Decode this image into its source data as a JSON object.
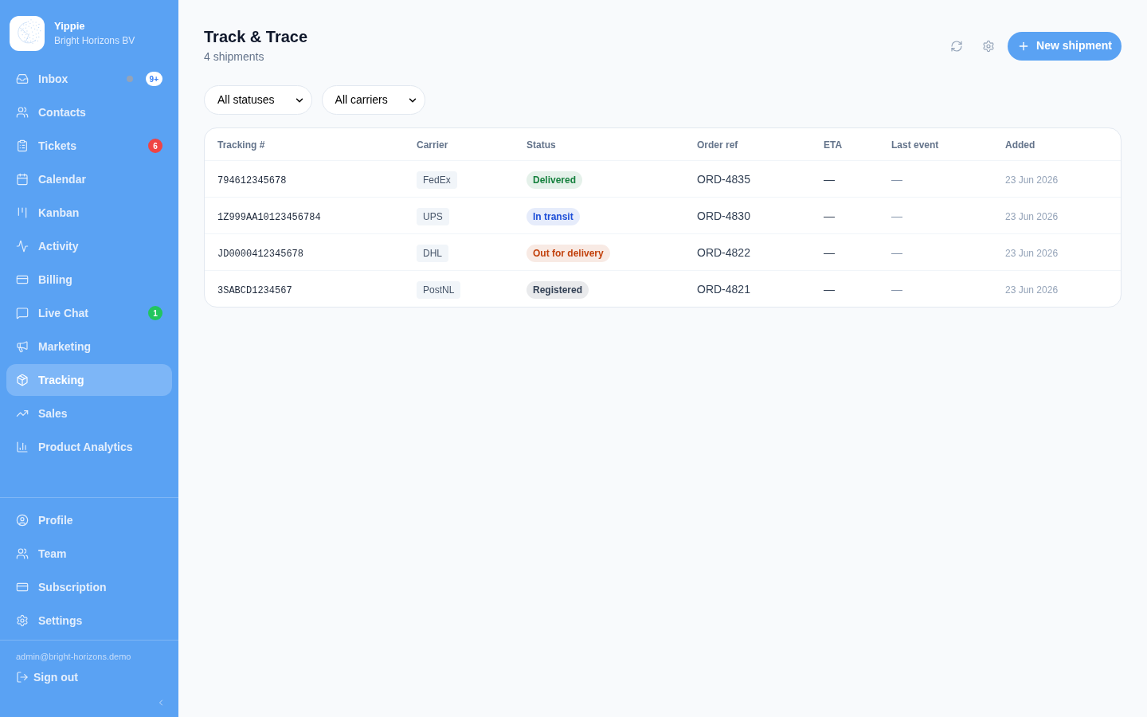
{
  "sidebar": {
    "brand": {
      "name": "Yippie",
      "subtitle": "Bright Horizons BV"
    },
    "nav": [
      {
        "label": "Inbox",
        "selected": false,
        "dot": {
          "color": "#94a3b8"
        },
        "badge": {
          "text": "9+",
          "color": "#ffffff"
        }
      },
      {
        "label": "Contacts",
        "selected": false
      },
      {
        "label": "Tickets",
        "selected": false,
        "badge": {
          "text": "6",
          "color": "#ef4444"
        }
      },
      {
        "label": "Calendar",
        "selected": false
      },
      {
        "label": "Kanban",
        "selected": false
      },
      {
        "label": "Activity",
        "selected": false
      },
      {
        "label": "Billing",
        "selected": false
      },
      {
        "label": "Live Chat",
        "selected": false,
        "badge": {
          "text": "1",
          "color": "#22c55e"
        }
      },
      {
        "label": "Marketing",
        "selected": false
      },
      {
        "label": "Tracking",
        "selected": true
      },
      {
        "label": "Sales",
        "selected": false
      },
      {
        "label": "Product Analytics",
        "selected": false
      }
    ],
    "account_nav": [
      {
        "label": "Profile",
        "selected": false
      },
      {
        "label": "Team",
        "selected": false
      },
      {
        "label": "Subscription",
        "selected": false
      },
      {
        "label": "Settings",
        "selected": false
      }
    ],
    "user_email": "admin@bright-horizons.demo",
    "sign_out": "Sign out"
  },
  "header": {
    "title": "Track & Trace",
    "subtitle": "4 shipments",
    "primary_button": "New shipment"
  },
  "filters": [
    {
      "value": "All statuses"
    },
    {
      "value": "All carriers"
    }
  ],
  "table": {
    "columns": [
      "Tracking #",
      "Carrier",
      "Status",
      "Order ref",
      "ETA",
      "Last event",
      "Added"
    ],
    "rows": [
      {
        "tracking": "794612345678",
        "carrier": "FedEx",
        "status": {
          "text": "Delivered",
          "color": "#15803d"
        },
        "order_ref": "ORD-4835",
        "eta": "—",
        "last_event": "—",
        "added": "23 Jun 2026"
      },
      {
        "tracking": "1Z999AA10123456784",
        "carrier": "UPS",
        "status": {
          "text": "In transit",
          "color": "#1d4ed8"
        },
        "order_ref": "ORD-4830",
        "eta": "—",
        "last_event": "—",
        "added": "23 Jun 2026"
      },
      {
        "tracking": "JD0000412345678",
        "carrier": "DHL",
        "status": {
          "text": "Out for delivery",
          "color": "#c2410c"
        },
        "order_ref": "ORD-4822",
        "eta": "—",
        "last_event": "—",
        "added": "23 Jun 2026"
      },
      {
        "tracking": "3SABCD1234567",
        "carrier": "PostNL",
        "status": {
          "text": "Registered",
          "color": "#334155"
        },
        "order_ref": "ORD-4821",
        "eta": "—",
        "last_event": "—",
        "added": "23 Jun 2026"
      }
    ]
  }
}
